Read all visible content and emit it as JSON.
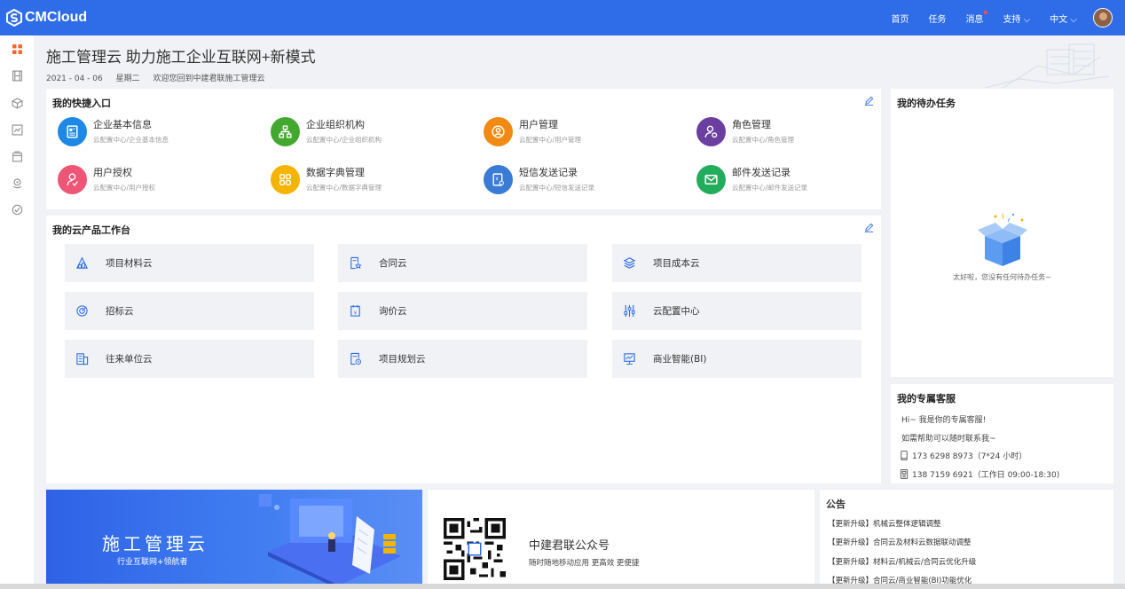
{
  "brand": {
    "logo_text": "CMCloud",
    "primary_color": "#2f6de8"
  },
  "nav": {
    "home": "首页",
    "tasks": "任务",
    "messages": "消息",
    "support": "支持",
    "support_arrow": "⌵",
    "language": "中文",
    "language_arrow": "⌵"
  },
  "sidebar": {
    "items": [
      "grid-icon",
      "film-icon",
      "box-icon",
      "chart-icon",
      "window-icon",
      "location-icon",
      "gauge-icon"
    ]
  },
  "header": {
    "title": "施工管理云 助力施工企业互联网+新模式",
    "date": "2021 - 04 - 06",
    "weekday": "星期二",
    "welcome": "欢迎您回到中建君联施工管理云"
  },
  "quick": {
    "title": "我的快捷入口",
    "items": [
      {
        "name": "企业基本信息",
        "path": "云配置中心/企业基本信息",
        "color": "#1e88e5",
        "icon": "id-card-icon"
      },
      {
        "name": "企业组织机构",
        "path": "云配置中心/企业组织机构",
        "color": "#43a82f",
        "icon": "org-chart-icon"
      },
      {
        "name": "用户管理",
        "path": "云配置中心/用户管理",
        "color": "#f08a12",
        "icon": "user-circle-icon"
      },
      {
        "name": "角色管理",
        "path": "云配置中心/角色管理",
        "color": "#6a3fa0",
        "icon": "user-gear-icon"
      },
      {
        "name": "用户授权",
        "path": "云配置中心/用户授权",
        "color": "#ef5577",
        "icon": "user-check-icon"
      },
      {
        "name": "数据字典管理",
        "path": "云配置中心/数据字典管理",
        "color": "#f4b400",
        "icon": "grid-dict-icon"
      },
      {
        "name": "短信发送记录",
        "path": "云配置中心/短信发送记录",
        "color": "#3a7bd5",
        "icon": "sms-doc-icon"
      },
      {
        "name": "邮件发送记录",
        "path": "云配置中心/邮件发送记录",
        "color": "#22ad5c",
        "icon": "mail-icon"
      }
    ]
  },
  "workbench": {
    "title": "我的云产品工作台",
    "items": [
      {
        "label": "项目材料云",
        "icon": "material-icon"
      },
      {
        "label": "合同云",
        "icon": "contract-icon"
      },
      {
        "label": "项目成本云",
        "icon": "layers-icon"
      },
      {
        "label": "招标云",
        "icon": "target-icon"
      },
      {
        "label": "询价云",
        "icon": "price-doc-icon"
      },
      {
        "label": "云配置中心",
        "icon": "sliders-icon"
      },
      {
        "label": "往来单位云",
        "icon": "building-icon"
      },
      {
        "label": "项目规划云",
        "icon": "plan-doc-icon"
      },
      {
        "label": "商业智能(BI)",
        "icon": "bi-board-icon"
      }
    ]
  },
  "todo": {
    "title": "我的待办任务",
    "empty_text": "太好啦，您没有任何待办任务~"
  },
  "service": {
    "title": "我的专属客服",
    "greeting": "Hi~ 我是你的专属客服!",
    "help": "如需帮助可以随时联系我~",
    "phone1": "173 6298 8973（7*24 小时）",
    "phone2": "138 7159 6921（工作日 09:00-18:30)"
  },
  "banner": {
    "title": "施工管理云",
    "subtitle": "行业互联网+领航者"
  },
  "wechat": {
    "title": "中建君联公众号",
    "subtitle": "随时随地移动应用 更高效 更便捷"
  },
  "notice": {
    "title": "公告",
    "items": [
      "【更新升级】机械云整体逻辑调整",
      "【更新升级】合同云及材料云数据联动调整",
      "【更新升级】材料云/机械云/合同云优化升级",
      "【更新升级】合同云/商业智能(BI)功能优化"
    ]
  }
}
